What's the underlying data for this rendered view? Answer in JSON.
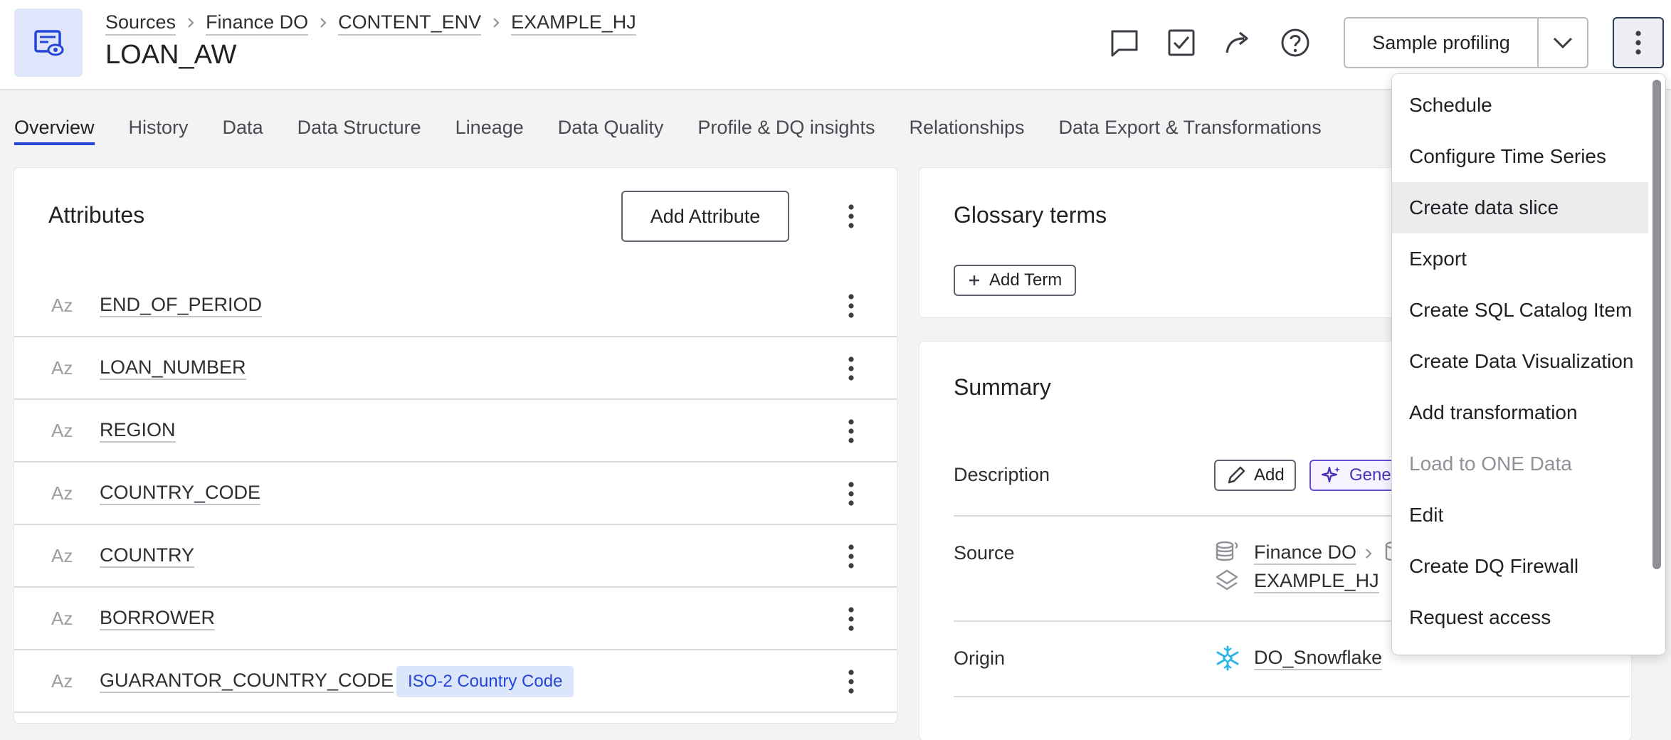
{
  "breadcrumb": {
    "items": [
      "Sources",
      "Finance DO",
      "CONTENT_ENV",
      "EXAMPLE_HJ"
    ]
  },
  "title": "LOAN_AW",
  "header_actions": {
    "icons": [
      "comment-icon",
      "task-checkbox-icon",
      "share-icon",
      "help-icon"
    ],
    "sample_profiling_label": "Sample profiling"
  },
  "tabs": [
    {
      "label": "Overview",
      "active": true
    },
    {
      "label": "History"
    },
    {
      "label": "Data"
    },
    {
      "label": "Data Structure"
    },
    {
      "label": "Lineage"
    },
    {
      "label": "Data Quality"
    },
    {
      "label": "Profile & DQ insights"
    },
    {
      "label": "Relationships"
    },
    {
      "label": "Data Export & Transformations"
    }
  ],
  "attributes": {
    "title": "Attributes",
    "add_label": "Add Attribute",
    "rows": [
      {
        "type": "Az",
        "name": "END_OF_PERIOD"
      },
      {
        "type": "Az",
        "name": "LOAN_NUMBER"
      },
      {
        "type": "Az",
        "name": "REGION"
      },
      {
        "type": "Az",
        "name": "COUNTRY_CODE"
      },
      {
        "type": "Az",
        "name": "COUNTRY"
      },
      {
        "type": "Az",
        "name": "BORROWER"
      },
      {
        "type": "Az",
        "name": "GUARANTOR_COUNTRY_CODE",
        "tag": "ISO-2 Country Code"
      }
    ]
  },
  "glossary": {
    "title": "Glossary terms",
    "add_term_label": "Add Term"
  },
  "summary": {
    "title": "Summary",
    "description_label": "Description",
    "add_label": "Add",
    "generate_label": "Gener",
    "source_label": "Source",
    "source_primary": "Finance DO",
    "source_secondary": "EXAMPLE_HJ",
    "origin_label": "Origin",
    "origin_value": "DO_Snowflake"
  },
  "menu": {
    "items": [
      {
        "label": "Schedule"
      },
      {
        "label": "Configure Time Series"
      },
      {
        "label": "Create data slice",
        "hover": true
      },
      {
        "label": "Export"
      },
      {
        "label": "Create SQL Catalog Item"
      },
      {
        "label": "Create Data Visualization"
      },
      {
        "label": "Add transformation"
      },
      {
        "label": "Load to ONE Data",
        "disabled": true
      },
      {
        "label": "Edit"
      },
      {
        "label": "Create DQ Firewall"
      },
      {
        "label": "Request access"
      }
    ]
  },
  "colors": {
    "accent": "#2545d6",
    "tag_bg": "#dbe6fb",
    "generate": "#4b32b5",
    "snowflake": "#29b5e8"
  }
}
